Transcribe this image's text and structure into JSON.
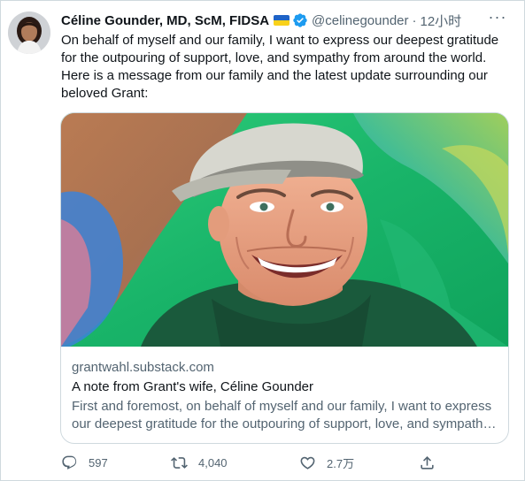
{
  "tweet": {
    "author": {
      "name": "Céline Gounder, MD, ScM, FIDSA",
      "flag_emoji": "🇺🇦",
      "handle": "@celinegounder",
      "separator": "·",
      "time": "12小时"
    },
    "text": "On behalf of myself and our family, I want to express our deepest gratitude for the outpouring of support, love, and sympathy from around the world. Here is a message from our family and the latest update surrounding our beloved Grant:",
    "card": {
      "domain": "grantwahl.substack.com",
      "title": "A note from Grant's wife, Céline Gounder",
      "description": "First and foremost, on behalf of myself and our family, I want to express our deepest gratitude for the outpouring of support, love, and sympathy from around the world."
    },
    "actions": {
      "replies": "597",
      "retweets": "4,040",
      "likes": "2.7万"
    }
  },
  "colors": {
    "accent": "#1d9bf0",
    "text_primary": "#0f1419",
    "text_secondary": "#536471",
    "border": "#cfd9de",
    "card_bg_green": "#1fae63"
  },
  "icons": {
    "verified": "verified-badge-icon",
    "more": "more-dots-icon",
    "reply": "reply-icon",
    "retweet": "retweet-icon",
    "like": "heart-icon",
    "share": "share-icon"
  }
}
